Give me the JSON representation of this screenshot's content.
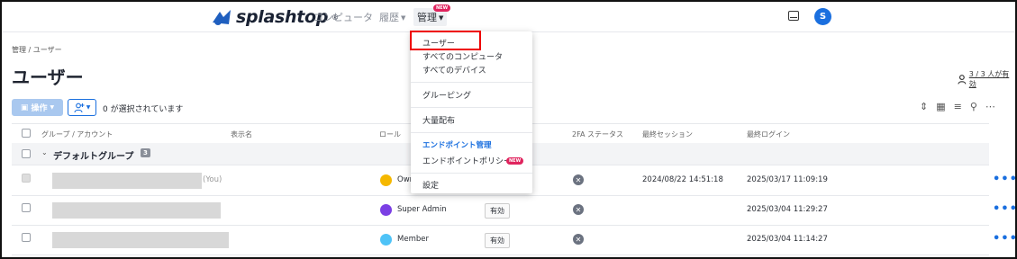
{
  "topbar": {
    "logo": "splashtop",
    "nav_computers": "コンピュータ",
    "nav_history": "履歴",
    "nav_admin": "管理",
    "new_badge": "NEW",
    "avatar_letter": "S"
  },
  "breadcrumb": "管理 / ユーザー",
  "page_title": "ユーザー",
  "active_count": "3 / 3 人が有効",
  "toolbar": {
    "ops_label": "操作",
    "selected_text": "0 が選択されています"
  },
  "table": {
    "headers": [
      "グループ / アカウント",
      "表示名",
      "ロール",
      "2FA ステータス",
      "最終セッション",
      "最終ログイン"
    ],
    "group": {
      "label": "デフォルトグループ",
      "count": "3"
    },
    "rows": [
      {
        "you": "(You)",
        "role": "Owner",
        "role_color": "#f5b800",
        "status": "",
        "last_session": "2024/08/22 14:51:18",
        "last_login": "2025/03/17 11:09:19",
        "dots": "•••"
      },
      {
        "you": "",
        "role": "Super Admin",
        "role_color": "#7b3fe4",
        "status": "有効",
        "last_session": "",
        "last_login": "2025/03/04 11:29:27",
        "dots": "•••"
      },
      {
        "you": "",
        "role": "Member",
        "role_color": "#4fc3f7",
        "status": "有効",
        "last_session": "",
        "last_login": "2025/03/04 11:14:27",
        "dots": "•••"
      }
    ]
  },
  "dropdown": {
    "users": "ユーザー",
    "all_computers": "すべてのコンピュータ",
    "all_devices": "すべてのデバイス",
    "grouping": "グルーピング",
    "mass_deploy": "大量配布",
    "endpoint_mgmt": "エンドポイント管理",
    "endpoint_policy": "エンドポイントポリシー",
    "settings": "設定"
  },
  "icons": [
    "splashtop-logo-icon",
    "inbox-icon",
    "person-icon",
    "add-user-icon",
    "density-icon",
    "columns-icon",
    "filter-icon",
    "search-icon",
    "more-icon",
    "chevron-down-icon",
    "x-circle-icon",
    "crown-icon",
    "star-icon",
    "circle-icon"
  ]
}
